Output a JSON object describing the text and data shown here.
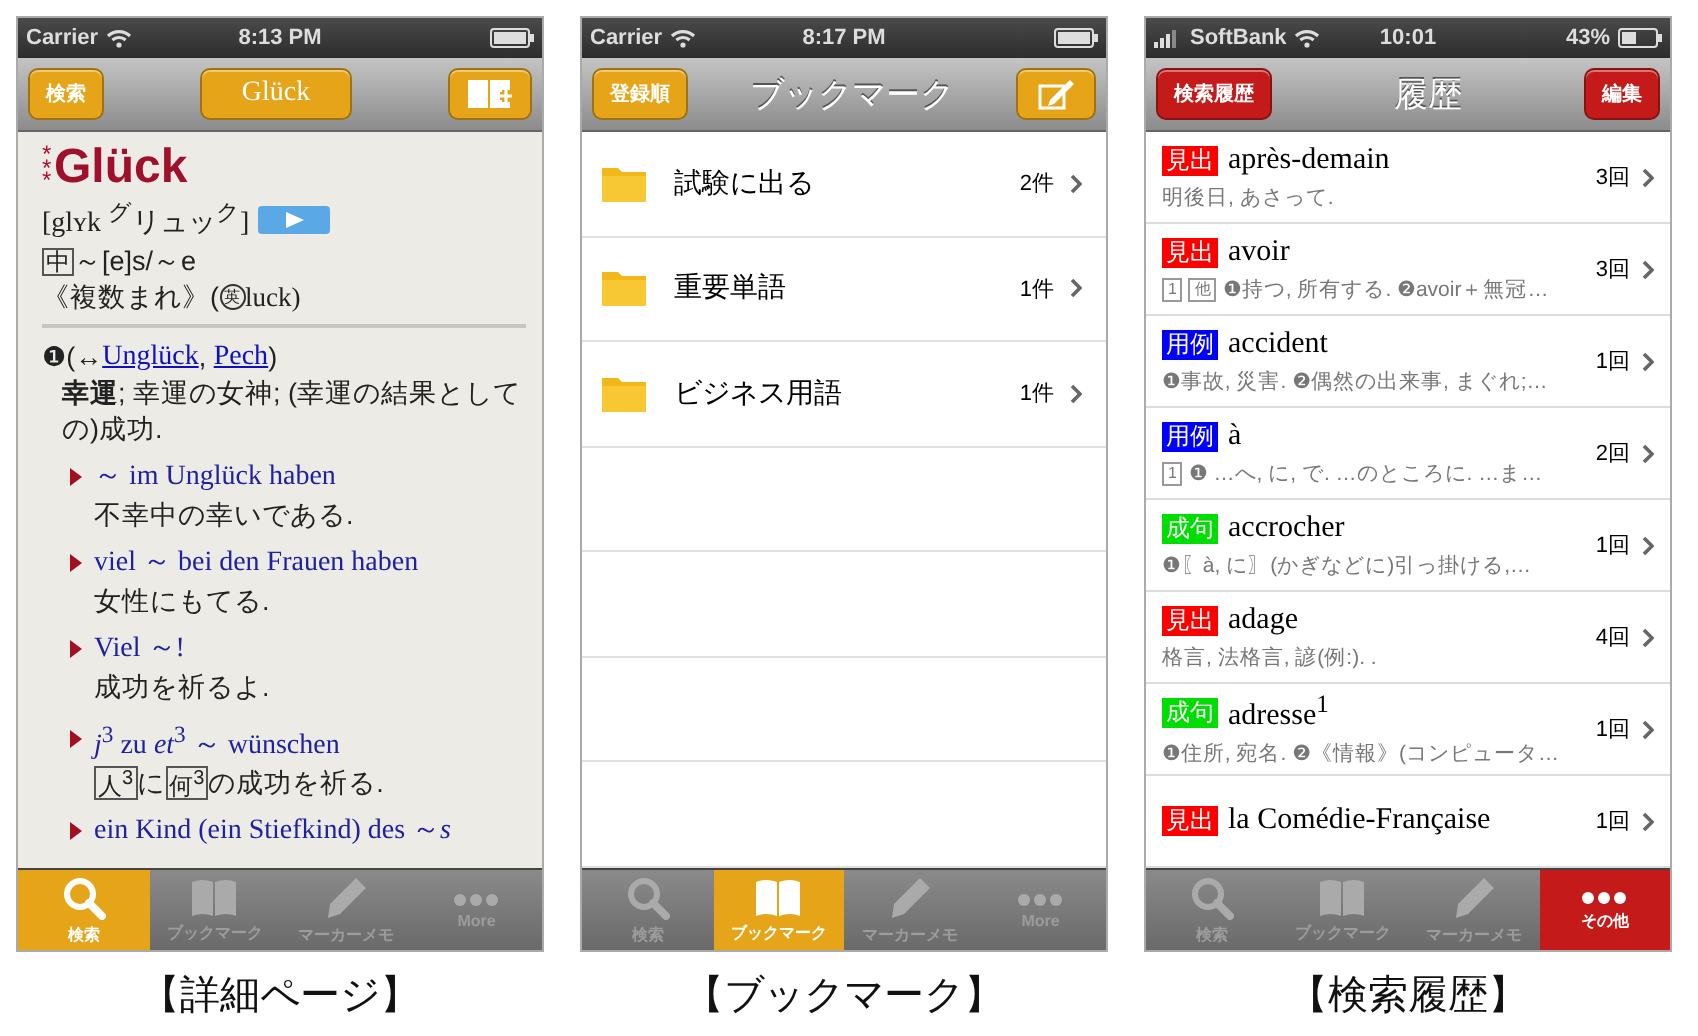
{
  "screens": [
    {
      "kind": "entry",
      "color": "#e6a418",
      "status": {
        "carrier": "Carrier",
        "time": "8:13 PM"
      },
      "nav": {
        "left": "検索",
        "title": {
          "kind": "button",
          "label": "Glück"
        },
        "right": {
          "kind": "book"
        }
      },
      "entry": {
        "stars": "***",
        "headword": "Glück",
        "pron": "[glʏk $^{グ}$リュッ$^{ク}$]",
        "gender": "中",
        "inflection": "～[e]s/～e",
        "usage_pre": "《複数まれ》(",
        "lang": "英",
        "usage_post": "luck)",
        "sense": {
          "num": "❶",
          "open": "(↔",
          "links": [
            "Unglück",
            "Pech"
          ],
          "separator": ", ",
          "close": ")",
          "meaning": "**幸運**; 幸運の女神; (幸運の結果としての)成功.",
          "examples": [
            {
              "de": "～ im Unglück haben",
              "ja": [
                {
                  "text": "不幸中の幸いである.",
                  "boxed": false
                }
              ]
            },
            {
              "de": "viel ～ bei den Frauen haben",
              "ja": [
                {
                  "text": "女性にもてる.",
                  "boxed": false
                }
              ]
            },
            {
              "de": "Viel ～!",
              "ja": [
                {
                  "text": "成功を祈るよ.",
                  "boxed": false
                }
              ]
            },
            {
              "de": "*j*$^{3}$ zu *et*$^{3}$ ～ wünschen",
              "ja": [
                {
                  "text": "人$^{3}$",
                  "boxed": true
                },
                {
                  "text": "に",
                  "boxed": false
                },
                {
                  "text": "何$^{3}$",
                  "boxed": true
                },
                {
                  "text": "の成功を祈る.",
                  "boxed": false
                }
              ]
            },
            {
              "de": "ein Kind (ein Stiefkind) des ～*s*"
            }
          ]
        }
      },
      "tabs": [
        {
          "kind": "search",
          "label": "検索",
          "selected": true
        },
        {
          "kind": "book",
          "label": "ブックマーク",
          "selected": false
        },
        {
          "kind": "pencil",
          "label": "マーカーメモ",
          "selected": false
        },
        {
          "kind": "dots",
          "label": "More",
          "selected": false
        }
      ],
      "caption": "【詳細ページ】"
    },
    {
      "kind": "bookmarks",
      "color": "#e6a418",
      "status": {
        "carrier": "Carrier",
        "time": "8:17 PM"
      },
      "nav": {
        "left": "登録順",
        "title": {
          "kind": "text",
          "label": "ブックマーク"
        },
        "right": {
          "kind": "edit"
        }
      },
      "folders": [
        {
          "name": "試験に出る",
          "count": "2件"
        },
        {
          "name": "重要単語",
          "count": "1件"
        },
        {
          "name": "ビジネス用語",
          "count": "1件"
        }
      ],
      "tabs": [
        {
          "kind": "search",
          "label": "検索",
          "selected": false
        },
        {
          "kind": "book",
          "label": "ブックマーク",
          "selected": true
        },
        {
          "kind": "pencil",
          "label": "マーカーメモ",
          "selected": false
        },
        {
          "kind": "dots",
          "label": "More",
          "selected": false
        }
      ],
      "caption": "【ブックマーク】"
    },
    {
      "kind": "history",
      "color": "#c41a1a",
      "status": {
        "carrier": "SoftBank",
        "time": "10:01",
        "battery": "43%",
        "signal_bars": true
      },
      "nav": {
        "left": "検索履歴",
        "title": {
          "kind": "text",
          "label": "履歴"
        },
        "right": {
          "kind": "text",
          "label": "編集"
        }
      },
      "history": [
        {
          "tag": {
            "label": "見出",
            "color": "#ff0000"
          },
          "word": "après-demain",
          "gloss": "明後日, あさって.",
          "count": "3回"
        },
        {
          "tag": {
            "label": "見出",
            "color": "#ff0000"
          },
          "word": "avoir",
          "boxes": [
            "1",
            "他"
          ],
          "gloss": "❶持つ, 所有する. ❷avoir＋無冠…",
          "count": "3回"
        },
        {
          "tag": {
            "label": "用例",
            "color": "#0000ff"
          },
          "word": "accident",
          "gloss": "❶事故, 災害. ❷偶然の出来事, まぐれ;…",
          "count": "1回"
        },
        {
          "tag": {
            "label": "用例",
            "color": "#0000ff"
          },
          "word": "à",
          "boxes": [
            "1"
          ],
          "gloss": "❶ …へ, に, で. …のところに. …ま…",
          "count": "2回"
        },
        {
          "tag": {
            "label": "成句",
            "color": "#00dd00"
          },
          "word": "accrocher",
          "gloss": "❶〖à, に〗(かぎなどに)引っ掛ける,…",
          "count": "1回"
        },
        {
          "tag": {
            "label": "見出",
            "color": "#ff0000"
          },
          "word": "adage",
          "gloss": "格言, 法格言, 諺(例:). .",
          "count": "4回"
        },
        {
          "tag": {
            "label": "成句",
            "color": "#00dd00"
          },
          "word": "adresse$^{1}$",
          "gloss": "❶住所, 宛名. ❷《情報》(コンピュータ…",
          "count": "1回"
        },
        {
          "tag": {
            "label": "見出",
            "color": "#ff0000"
          },
          "word": "la Comédie-Française",
          "count": "1回"
        }
      ],
      "tabs": [
        {
          "kind": "search",
          "label": "検索",
          "selected": false
        },
        {
          "kind": "book",
          "label": "ブックマーク",
          "selected": false
        },
        {
          "kind": "pencil",
          "label": "マーカーメモ",
          "selected": false
        },
        {
          "kind": "dots",
          "label": "その他",
          "selected": true
        }
      ],
      "caption": "【検索履歴】"
    }
  ]
}
